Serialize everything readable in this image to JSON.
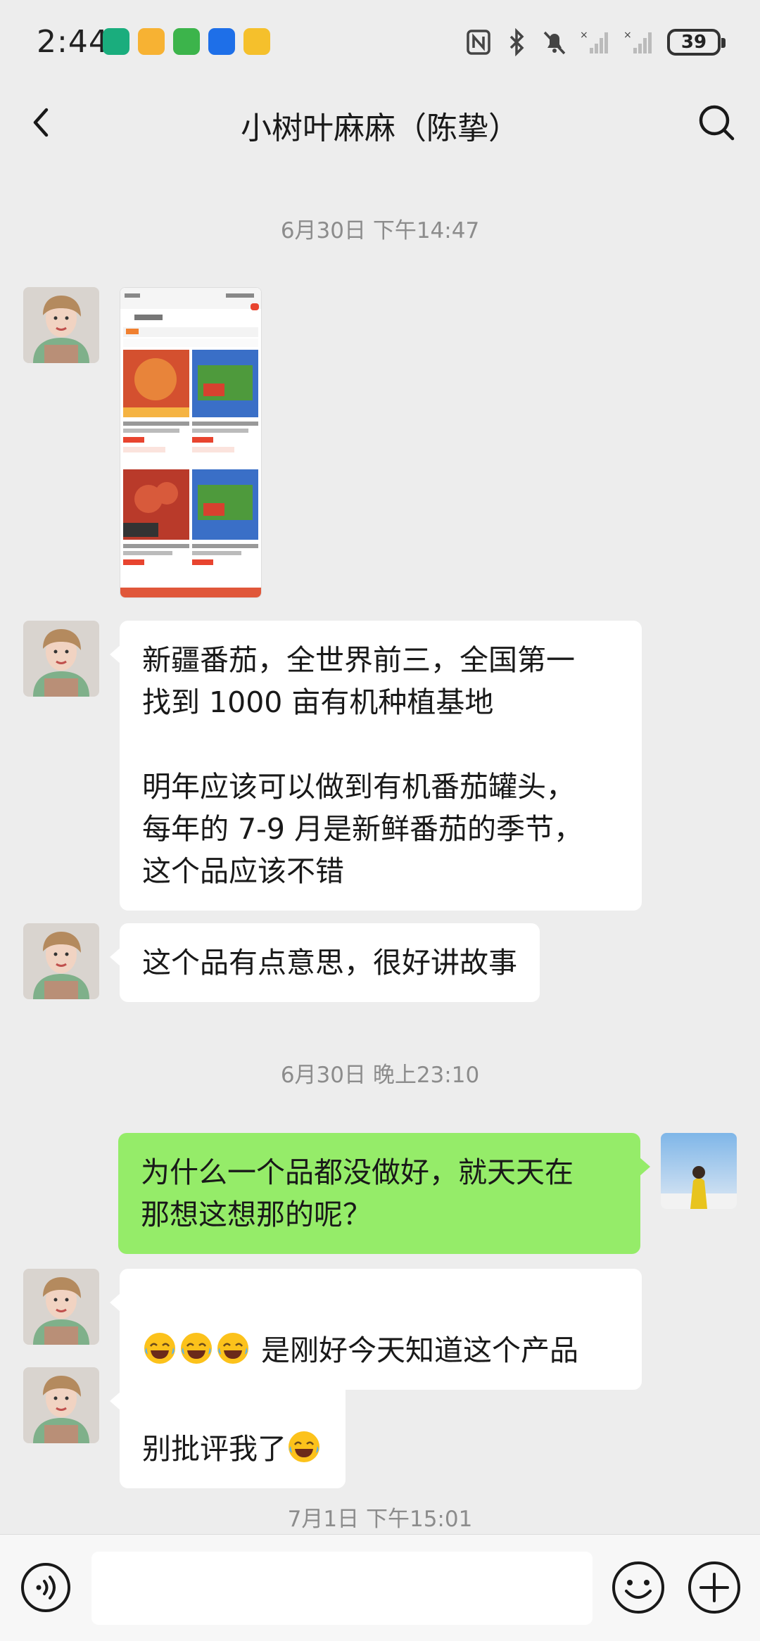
{
  "status_bar": {
    "time": "2:44",
    "battery": "39"
  },
  "header": {
    "title": "小树叶麻麻（陈挚）"
  },
  "messages": {
    "ts1": "6月30日 下午14:47",
    "m2": "新疆番茄，全世界前三，全国第一\n找到 1000 亩有机种植基地\n\n明年应该可以做到有机番茄罐头，\n每年的 7-9 月是新鲜番茄的季节，\n这个品应该不错",
    "m3": "这个品有点意思，很好讲故事",
    "ts2": "6月30日 晚上23:10",
    "m4": "为什么一个品都没做好，就天天在\n那想这想那的呢？",
    "m5": " 是刚好今天知道这个产品",
    "m6": "别批评我了",
    "ts3": "7月1日 下午15:01"
  },
  "input_bar": {
    "placeholder": ""
  },
  "colors": {
    "background": "#ededed",
    "bubble_in": "#ffffff",
    "bubble_out": "#95ec69",
    "timestamp": "#8c8c8c"
  },
  "icons": [
    "back-arrow-icon",
    "search-icon",
    "voice-icon",
    "emoji-icon",
    "plus-icon",
    "laughing-emoji-icon"
  ]
}
